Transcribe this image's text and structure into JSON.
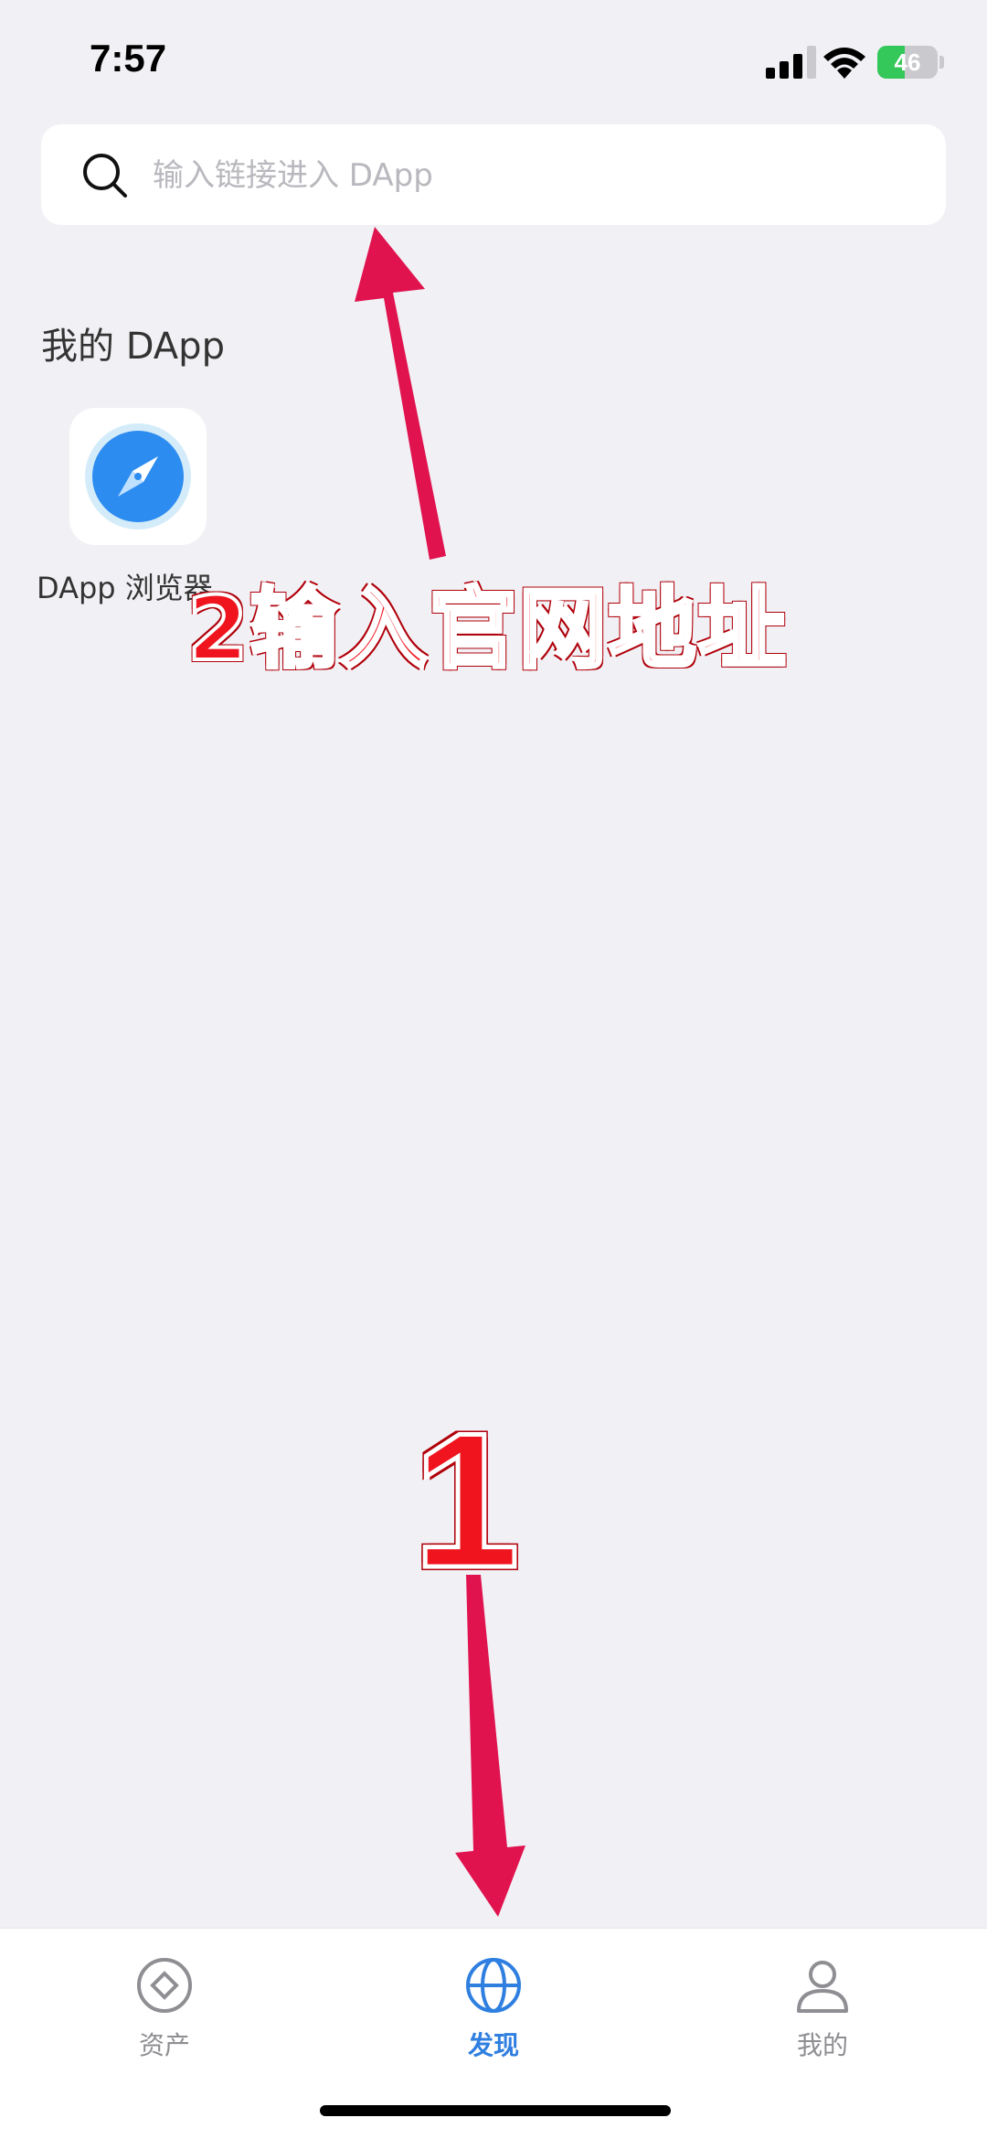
{
  "status_bar": {
    "time": "7:57",
    "battery_level": "46",
    "battery_fraction": 0.46,
    "icons": [
      "signal-icon",
      "wifi-icon",
      "battery-icon"
    ]
  },
  "search": {
    "placeholder": "输入链接进入 DApp",
    "value": ""
  },
  "my_dapps": {
    "title": "我的 DApp",
    "items": [
      {
        "label": "DApp 浏览器",
        "icon": "compass-icon"
      }
    ]
  },
  "annotations": {
    "step2": "2输入官网地址",
    "step1": "1"
  },
  "tabs": [
    {
      "label": "资产",
      "icon": "assets-icon",
      "active": false
    },
    {
      "label": "发现",
      "icon": "globe-icon",
      "active": true
    },
    {
      "label": "我的",
      "icon": "user-icon",
      "active": false
    }
  ],
  "colors": {
    "background": "#f1f1f5",
    "accent": "#2f7fe0",
    "inactive": "#8e8e93",
    "annotation_red": "#f0141e",
    "arrow": "#e0134f",
    "battery_green": "#34c759"
  }
}
